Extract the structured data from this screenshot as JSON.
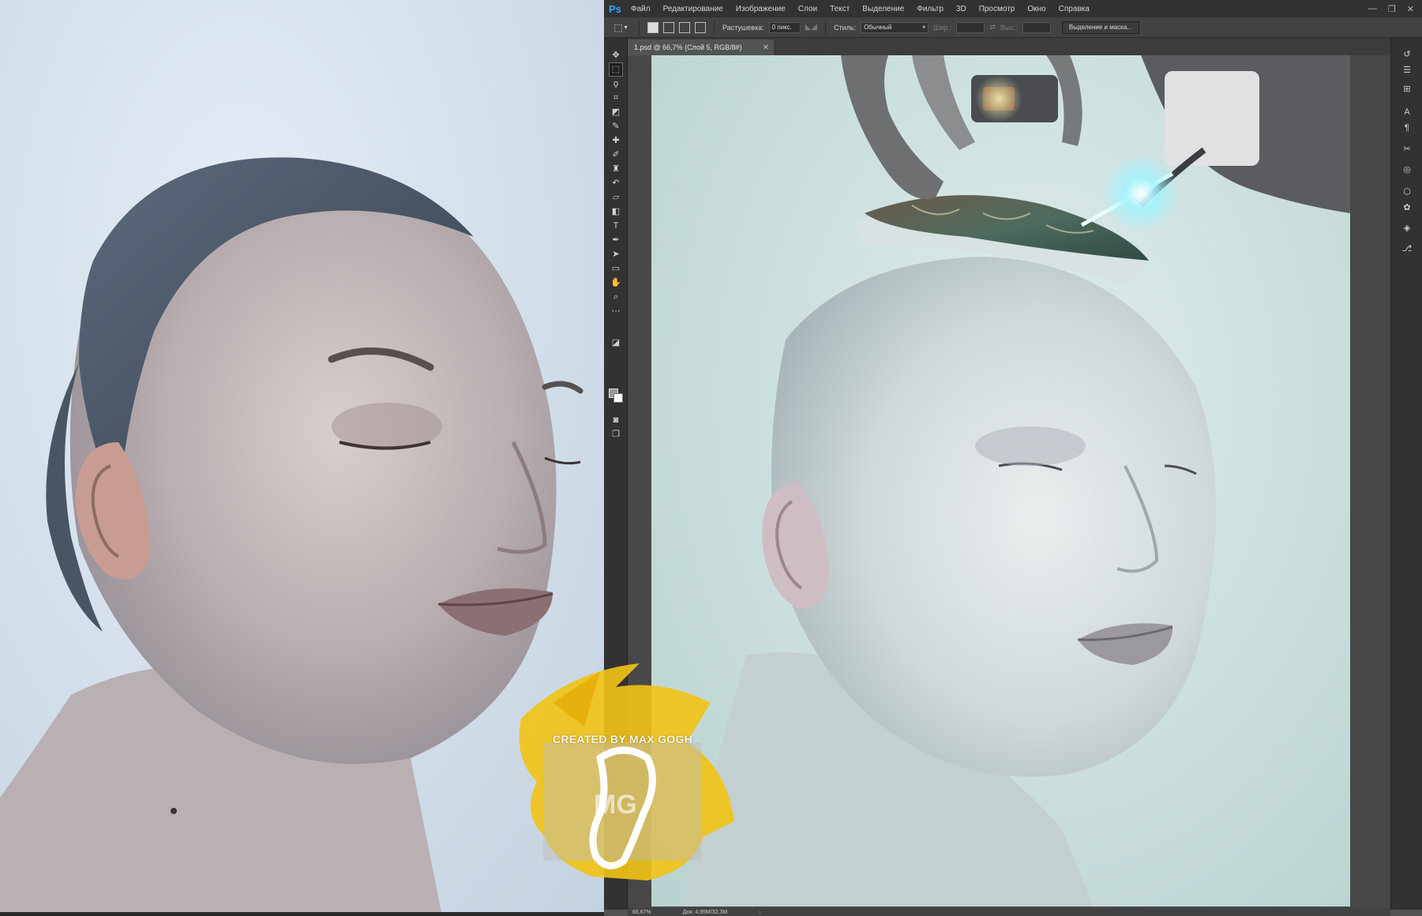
{
  "menubar": {
    "logo": "Ps",
    "items": [
      "Файл",
      "Редактирование",
      "Изображение",
      "Слои",
      "Текст",
      "Выделение",
      "Фильтр",
      "3D",
      "Просмотр",
      "Окно",
      "Справка"
    ],
    "minimize": "—",
    "restore": "❐",
    "close": "✕"
  },
  "options": {
    "feather_label": "Растушевка:",
    "feather_value": "0 пикс.",
    "style_label": "Стиль:",
    "style_value": "Обычный",
    "width_label": "Шир.:",
    "height_label": "Выс.:",
    "refine_button": "Выделение и маска..."
  },
  "document": {
    "tab_title": "1.psd @ 66,7% (Слой 5, RGB/8#)",
    "tab_close": "✕"
  },
  "status": {
    "zoom": "66,67%",
    "doc_size": "Док: 4,95M/32,3M",
    "arrow": "›"
  },
  "watermark": {
    "text": "CREATED BY MAX GOGH",
    "logo_letters": "MG"
  },
  "icons": {
    "tools": [
      "move-icon",
      "marquee-icon",
      "lasso-icon",
      "crop-icon",
      "frame-icon",
      "eyedropper-icon",
      "healing-icon",
      "brush-icon",
      "stamp-icon",
      "eraser-icon",
      "gradient-icon",
      "text-icon",
      "pen-icon",
      "path-select-icon",
      "shape-icon",
      "hand-icon",
      "zoom-icon",
      "more-icon"
    ],
    "panels": [
      "history-icon",
      "adjustments-icon",
      "properties-icon",
      "character-icon",
      "paragraph-icon",
      "tools-preset-icon",
      "channels-icon",
      "3d-icon",
      "color-icon",
      "layers-icon",
      "paths-icon"
    ]
  },
  "colors": {
    "accent": "#31a8ff",
    "panel": "#323232",
    "workspace": "#535353",
    "watermark_yellow": "#f2c314"
  }
}
